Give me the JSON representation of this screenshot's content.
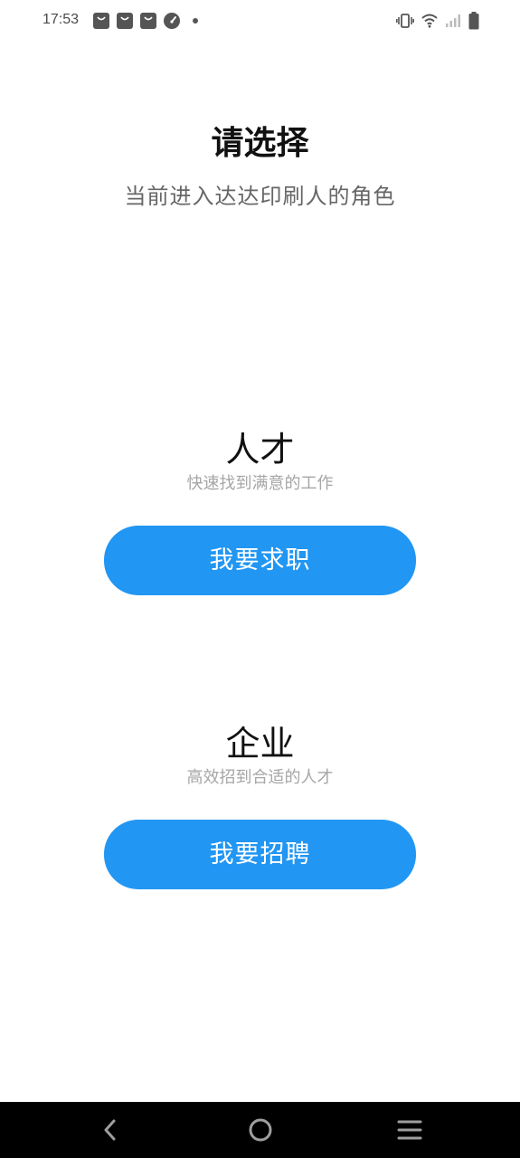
{
  "status_bar": {
    "time": "17:53",
    "notification_icons": [
      "shopping-bag-icon",
      "shopping-bag-icon",
      "shopping-bag-icon",
      "speedometer-icon",
      "dot-icon"
    ],
    "system_icons": [
      "vibrate-icon",
      "wifi-icon",
      "signal-icon",
      "battery-icon"
    ]
  },
  "header": {
    "title": "请选择",
    "subtitle": "当前进入达达印刷人的角色"
  },
  "roles": {
    "talent": {
      "title": "人才",
      "description": "快速找到满意的工作",
      "button_label": "我要求职"
    },
    "company": {
      "title": "企业",
      "description": "高效招到合适的人才",
      "button_label": "我要招聘"
    }
  },
  "navigation": {
    "icons": [
      "back-icon",
      "home-icon",
      "menu-icon"
    ]
  },
  "colors": {
    "accent": "#2196f3",
    "nav_background": "#000000",
    "background": "#ffffff"
  }
}
